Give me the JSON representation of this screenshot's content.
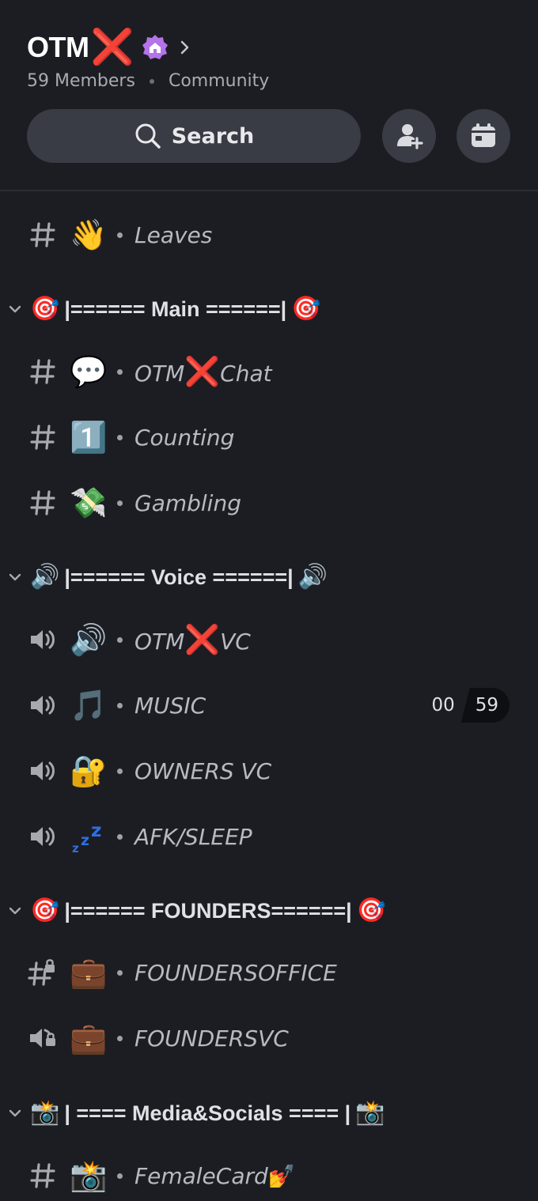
{
  "server": {
    "name": "OTM",
    "name_mark": "❌",
    "members": "59 Members",
    "type": "Community"
  },
  "search": {
    "label": "Search"
  },
  "accent": {
    "badge": "#b473e8",
    "red_x": "#e0242f",
    "zz": "#2f6fe0"
  },
  "channels_top": [
    {
      "kind": "text",
      "emoji": "👋",
      "name": "Leaves"
    }
  ],
  "categories": [
    {
      "emoji": "🎯",
      "label": "|====== Main ======|",
      "channels": [
        {
          "kind": "text",
          "emoji": "💬",
          "name_prefix": "OTM",
          "name_mark": "❌",
          "name_suffix": "Chat"
        },
        {
          "kind": "text",
          "emoji": "1️⃣",
          "name": "Counting"
        },
        {
          "kind": "text",
          "emoji": "💸",
          "name": "Gambling"
        }
      ]
    },
    {
      "emoji": "🔊",
      "label": "|====== Voice ======|",
      "channels": [
        {
          "kind": "voice",
          "emoji": "🔊",
          "name_prefix": "OTM",
          "name_mark": "❌",
          "name_suffix": "VC"
        },
        {
          "kind": "voice",
          "emoji": "🎵",
          "name": "MUSIC",
          "count_left": "00",
          "count_right": "59"
        },
        {
          "kind": "voice",
          "emoji": "🔐",
          "name": "OWNERS VC"
        },
        {
          "kind": "voice",
          "emoji": "zzz",
          "name": "AFK/SLEEP"
        }
      ]
    },
    {
      "emoji": "🎯",
      "label": "|====== FOUNDERS======|",
      "channels": [
        {
          "kind": "text-locked",
          "emoji": "💼",
          "name": "FOUNDERSOFFICE"
        },
        {
          "kind": "voice-locked",
          "emoji": "💼",
          "name": "FOUNDERSVC"
        }
      ]
    },
    {
      "emoji": "📸",
      "label": "| ==== Media&Socials ==== |",
      "channels": [
        {
          "kind": "text",
          "emoji": "📸",
          "name": "FemaleCard",
          "name_mark": "💅"
        }
      ]
    }
  ]
}
